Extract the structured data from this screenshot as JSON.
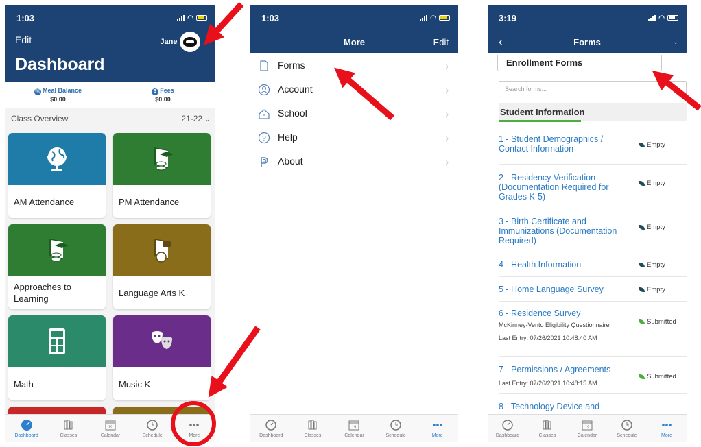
{
  "colors": {
    "navy": "#1c4373",
    "accent": "#2f7fcf",
    "link": "#2a7bc4",
    "arrow": "#e8101a",
    "green": "#4caf3d"
  },
  "phone1": {
    "time": "1:03",
    "edit_label": "Edit",
    "user_name": "Jane",
    "title": "Dashboard",
    "meal_balance_label": "Meal Balance",
    "meal_balance_value": "$0.00",
    "fees_label": "Fees",
    "fees_value": "$0.00",
    "class_overview_label": "Class Overview",
    "year_label": "21-22",
    "tiles": [
      {
        "label": "AM Attendance",
        "color": "#1f7ba8",
        "icon": "globe-icon"
      },
      {
        "label": "PM Attendance",
        "color": "#2e7d32",
        "icon": "grad-cap-icon"
      },
      {
        "label": "Approaches to Learning",
        "color": "#2e7d32",
        "icon": "grad-cap-icon"
      },
      {
        "label": "Language Arts K",
        "color": "#8a6d1a",
        "icon": "apple-book-icon"
      },
      {
        "label": "Math",
        "color": "#2a8a6a",
        "icon": "calculator-icon"
      },
      {
        "label": "Music K",
        "color": "#6a2d8a",
        "icon": "theater-masks-icon"
      }
    ],
    "tabs": [
      "Dashboard",
      "Classes",
      "Calendar",
      "Schedule",
      "More"
    ]
  },
  "phone2": {
    "time": "1:03",
    "title": "More",
    "edit_label": "Edit",
    "menu": [
      "Forms",
      "Account",
      "School",
      "Help",
      "About"
    ],
    "tabs": [
      "Dashboard",
      "Classes",
      "Calendar",
      "Schedule",
      "More"
    ]
  },
  "phone3": {
    "time": "3:19",
    "title": "Forms",
    "dropdown_value": "Enrollment Forms",
    "search_placeholder": "Search forms...",
    "section": "Student Information",
    "forms": [
      {
        "title": "1 - Student Demographics / Contact Information",
        "status": "Empty"
      },
      {
        "title": "2 - Residency Verification (Documentation Required for Grades K-5)",
        "status": "Empty"
      },
      {
        "title": "3 - Birth Certificate and Immunizations (Documentation Required)",
        "status": "Empty"
      },
      {
        "title": "4 - Health Information",
        "status": "Empty"
      },
      {
        "title": "5 - Home Language Survey",
        "status": "Empty"
      },
      {
        "title": "6 - Residence Survey",
        "subtitle": "McKinney-Vento Eligibility Questionnaire",
        "last_entry": "Last Entry: 07/26/2021 10:48:40 AM",
        "status": "Submitted"
      },
      {
        "title": "7 - Permissions / Agreements",
        "last_entry": "Last Entry: 07/26/2021 10:48:15 AM",
        "status": "Submitted"
      },
      {
        "title": "8 - Technology Device and"
      }
    ],
    "tabs": [
      "Dashboard",
      "Classes",
      "Calendar",
      "Schedule",
      "More"
    ]
  }
}
